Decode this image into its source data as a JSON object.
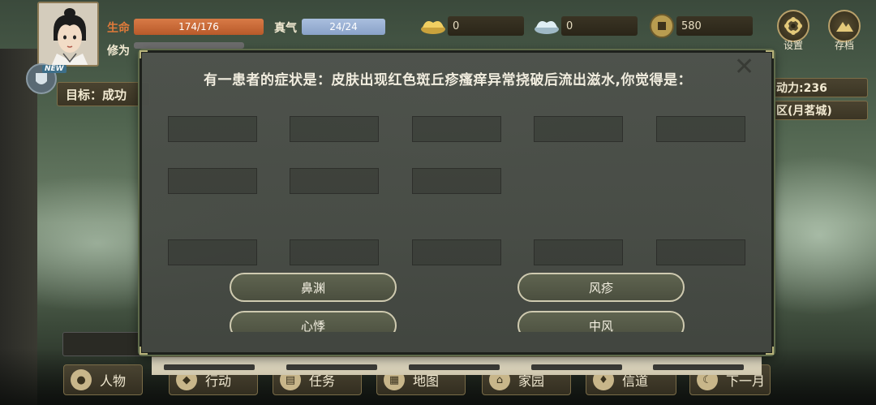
{
  "hud": {
    "hp_label": "生命",
    "hp_value": "174/176",
    "hp_color": "#c9683a",
    "qi_label": "真气",
    "qi_value": "24/24",
    "qi_color": "#9bb0d4",
    "cultivation_label": "修为",
    "gold": "0",
    "silver": "0",
    "coins": "580",
    "settings_label": "设置",
    "save_label": "存档"
  },
  "left_panel": {
    "new_badge": "NEW",
    "goal_text": "目标：成功"
  },
  "right_panel": {
    "stamina_text": "动力:236",
    "location_text": "区(月茗城)"
  },
  "quiz": {
    "question": "有一患者的症状是：皮肤出现红色斑丘疹瘙痒异常挠破后流出滋水,你觉得是：",
    "answers": [
      "鼻渊",
      "风疹",
      "心悸",
      "中风"
    ]
  },
  "bottom_nav": {
    "items": [
      "人物",
      "行动",
      "任务",
      "地图",
      "家园",
      "信道",
      "下一月"
    ]
  },
  "colors": {
    "modal_bg": "#4e524c",
    "answer_border": "#cfcab0",
    "hud_gold": "#e2c25a"
  }
}
